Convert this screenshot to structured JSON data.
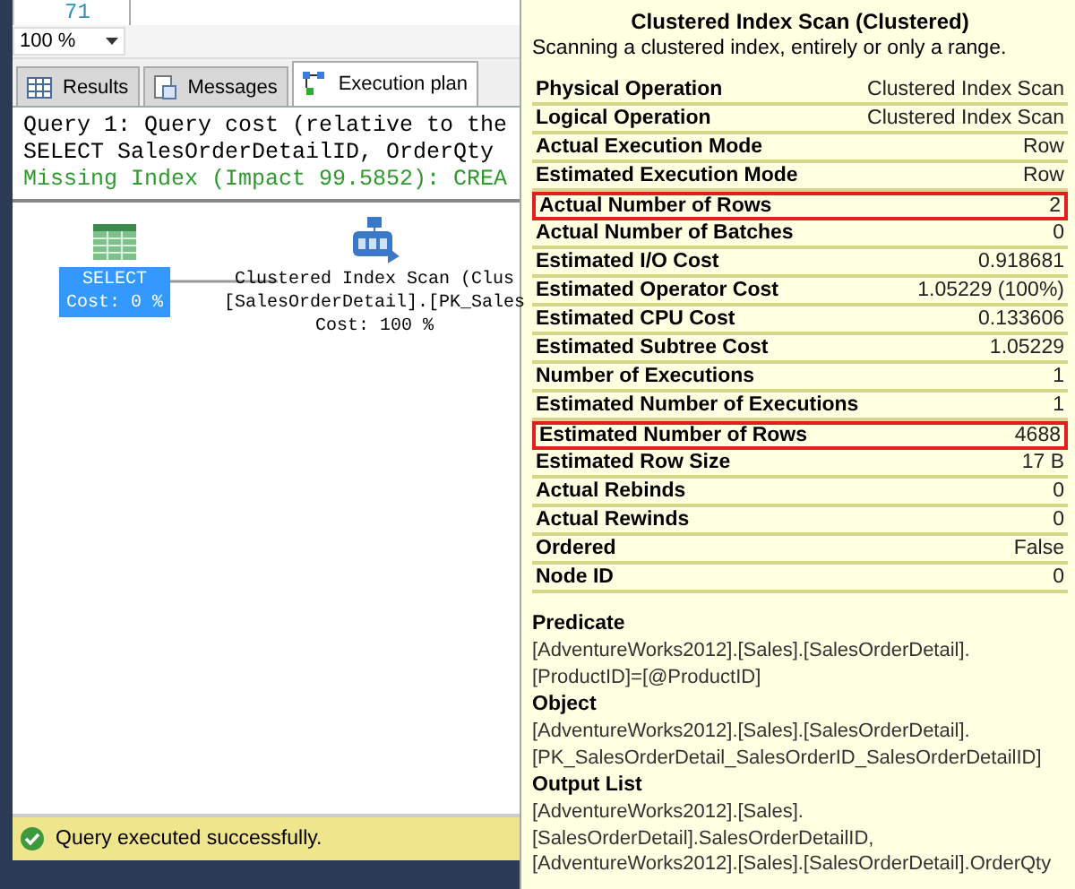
{
  "editor": {
    "line_number": "71"
  },
  "zoom": {
    "value": "100 %"
  },
  "tabs": [
    {
      "label": "Results",
      "kind": "grid",
      "selected": false
    },
    {
      "label": "Messages",
      "kind": "doc",
      "selected": false
    },
    {
      "label": "Execution plan",
      "kind": "plan",
      "selected": true
    }
  ],
  "query_lines": [
    {
      "kind": "plain",
      "text": "Query 1: Query cost (relative to the"
    },
    {
      "kind": "plain",
      "text": "SELECT SalesOrderDetailID, OrderQty"
    },
    {
      "kind": "hint",
      "text": "Missing Index (Impact 99.5852): CREA"
    }
  ],
  "plan": {
    "nodes": [
      {
        "kind": "select",
        "lines": [
          "SELECT",
          "Cost: 0 %"
        ],
        "selected": true
      },
      {
        "kind": "scan",
        "lines": [
          "Clustered Index Scan (Clus",
          "[SalesOrderDetail].[PK_Sales",
          "Cost: 100 %"
        ],
        "selected": false
      }
    ]
  },
  "status_bar": {
    "text": "Query executed successfully."
  },
  "tooltip": {
    "title": "Clustered Index Scan (Clustered)",
    "description": "Scanning a clustered index, entirely or only a range.",
    "rows": [
      {
        "label": "Physical Operation",
        "value": "Clustered Index Scan",
        "highlighted": false
      },
      {
        "label": "Logical Operation",
        "value": "Clustered Index Scan",
        "highlighted": false
      },
      {
        "label": "Actual Execution Mode",
        "value": "Row",
        "highlighted": false
      },
      {
        "label": "Estimated Execution Mode",
        "value": "Row",
        "highlighted": false
      },
      {
        "label": "Actual Number of Rows",
        "value": "2",
        "highlighted": true
      },
      {
        "label": "Actual Number of Batches",
        "value": "0",
        "highlighted": false
      },
      {
        "label": "Estimated I/O Cost",
        "value": "0.918681",
        "highlighted": false
      },
      {
        "label": "Estimated Operator Cost",
        "value": "1.05229 (100%)",
        "highlighted": false
      },
      {
        "label": "Estimated CPU Cost",
        "value": "0.133606",
        "highlighted": false
      },
      {
        "label": "Estimated Subtree Cost",
        "value": "1.05229",
        "highlighted": false
      },
      {
        "label": "Number of Executions",
        "value": "1",
        "highlighted": false
      },
      {
        "label": "Estimated Number of Executions",
        "value": "1",
        "highlighted": false
      },
      {
        "label": "Estimated Number of Rows",
        "value": "4688",
        "highlighted": true
      },
      {
        "label": "Estimated Row Size",
        "value": "17 B",
        "highlighted": false
      },
      {
        "label": "Actual Rebinds",
        "value": "0",
        "highlighted": false
      },
      {
        "label": "Actual Rewinds",
        "value": "0",
        "highlighted": false
      },
      {
        "label": "Ordered",
        "value": "False",
        "highlighted": false
      },
      {
        "label": "Node ID",
        "value": "0",
        "highlighted": false
      }
    ],
    "sections": [
      {
        "heading": "Predicate",
        "lines": [
          "[AdventureWorks2012].[Sales].[SalesOrderDetail].",
          "[ProductID]=[@ProductID]"
        ]
      },
      {
        "heading": "Object",
        "lines": [
          "[AdventureWorks2012].[Sales].[SalesOrderDetail].",
          "[PK_SalesOrderDetail_SalesOrderID_SalesOrderDetailID]"
        ]
      },
      {
        "heading": "Output List",
        "lines": [
          "[AdventureWorks2012].[Sales].",
          "[SalesOrderDetail].SalesOrderDetailID,",
          "[AdventureWorks2012].[Sales].[SalesOrderDetail].OrderQty"
        ]
      }
    ]
  }
}
